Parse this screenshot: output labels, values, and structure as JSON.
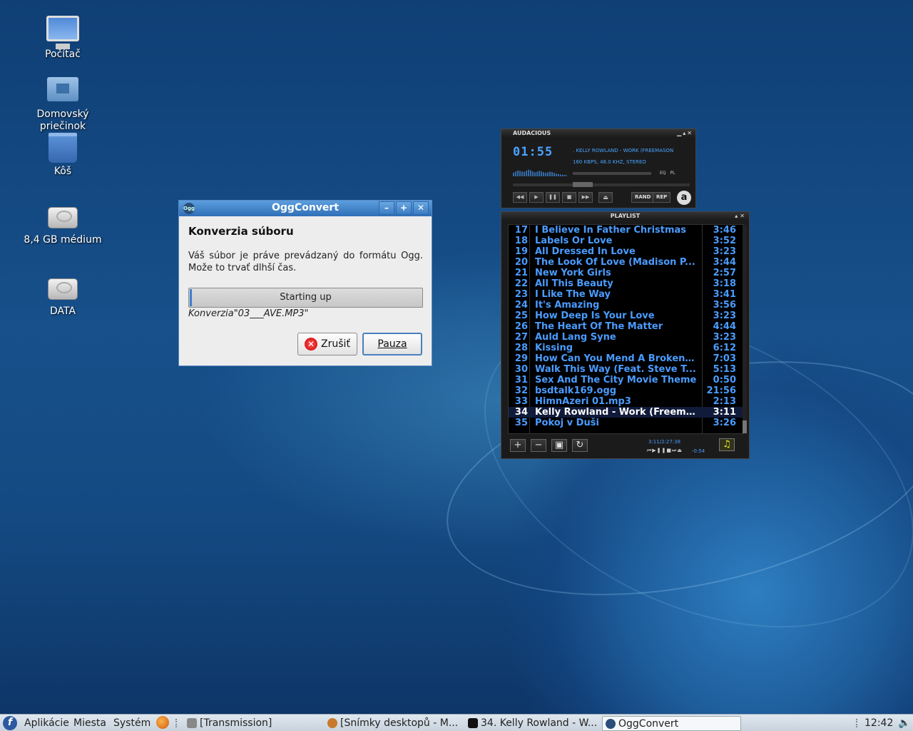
{
  "desktop_icons": [
    {
      "label": "Počítač",
      "icon": "computer-icon"
    },
    {
      "label": "Domovský priečinok",
      "icon": "home-folder-icon"
    },
    {
      "label": "Kôš",
      "icon": "trash-icon"
    },
    {
      "label": "8,4 GB médium",
      "icon": "drive-icon"
    },
    {
      "label": "DATA",
      "icon": "drive-icon"
    }
  ],
  "oggconvert": {
    "title": "OggConvert",
    "heading": "Konverzia súboru",
    "message": "Váš súbor je práve prevádzaný do formátu Ogg. Može to trvať dlhší čas.",
    "progress_label": "Starting up",
    "progress": 0.01,
    "file_label": "Konverzia\"03___AVE.MP3\"",
    "cancel_label": "Zrušiť",
    "pause_label": "Pauza"
  },
  "audacious": {
    "title": "AUDACIOUS",
    "time": "01:55",
    "marquee": ". KELLY ROWLAND - WORK (FREEMASON",
    "info": "160 KBPS, 48.0 KHZ, STEREO",
    "eq_label": "EQ",
    "pl_label": "PL",
    "rand_label": "RAND",
    "rep_label": "REP",
    "logo": "a"
  },
  "playlist": {
    "title": "PLAYLIST",
    "items": [
      {
        "n": "17",
        "title": "I Believe In Father Christmas",
        "dur": "3:46"
      },
      {
        "n": "18",
        "title": "Labels Or Love",
        "dur": "3:52"
      },
      {
        "n": "19",
        "title": "All Dressed In Love",
        "dur": "3:23"
      },
      {
        "n": "20",
        "title": "The Look Of Love (Madison P...",
        "dur": "3:44"
      },
      {
        "n": "21",
        "title": "New York Girls",
        "dur": "2:57"
      },
      {
        "n": "22",
        "title": "All This Beauty",
        "dur": "3:18"
      },
      {
        "n": "23",
        "title": "I Like The Way",
        "dur": "3:41"
      },
      {
        "n": "24",
        "title": "It's Amazing",
        "dur": "3:56"
      },
      {
        "n": "25",
        "title": "How Deep Is Your Love",
        "dur": "3:23"
      },
      {
        "n": "26",
        "title": "The Heart Of The Matter",
        "dur": "4:44"
      },
      {
        "n": "27",
        "title": "Auld Lang Syne",
        "dur": "3:23"
      },
      {
        "n": "28",
        "title": "Kissing",
        "dur": "6:12"
      },
      {
        "n": "29",
        "title": "How Can You Mend A Broken H...",
        "dur": "7:03"
      },
      {
        "n": "30",
        "title": "Walk This Way (Feat. Steve T...",
        "dur": "5:13"
      },
      {
        "n": "31",
        "title": "Sex And The City Movie Theme",
        "dur": "0:50"
      },
      {
        "n": "32",
        "title": "bsdtalk169.ogg",
        "dur": "21:56"
      },
      {
        "n": "33",
        "title": "HimnAzeri 01.mp3",
        "dur": "2:13"
      },
      {
        "n": "34",
        "title": "Kelly Rowland - Work (Freema...",
        "dur": "3:11"
      },
      {
        "n": "35",
        "title": "Pokoj v Duši",
        "dur": "3:26"
      }
    ],
    "current_index": 17,
    "total_time": "3:11/2:27:38",
    "remaining": "-0:54"
  },
  "taskbar": {
    "menu_apps": "Aplikácie",
    "menu_places": "Miesta",
    "menu_system": "Systém",
    "tasks": [
      {
        "label": "[Transmission]"
      },
      {
        "label": "[Snímky desktopů - M..."
      },
      {
        "label": "34. Kelly Rowland - W..."
      },
      {
        "label": "OggConvert"
      }
    ],
    "clock": "12:42"
  }
}
